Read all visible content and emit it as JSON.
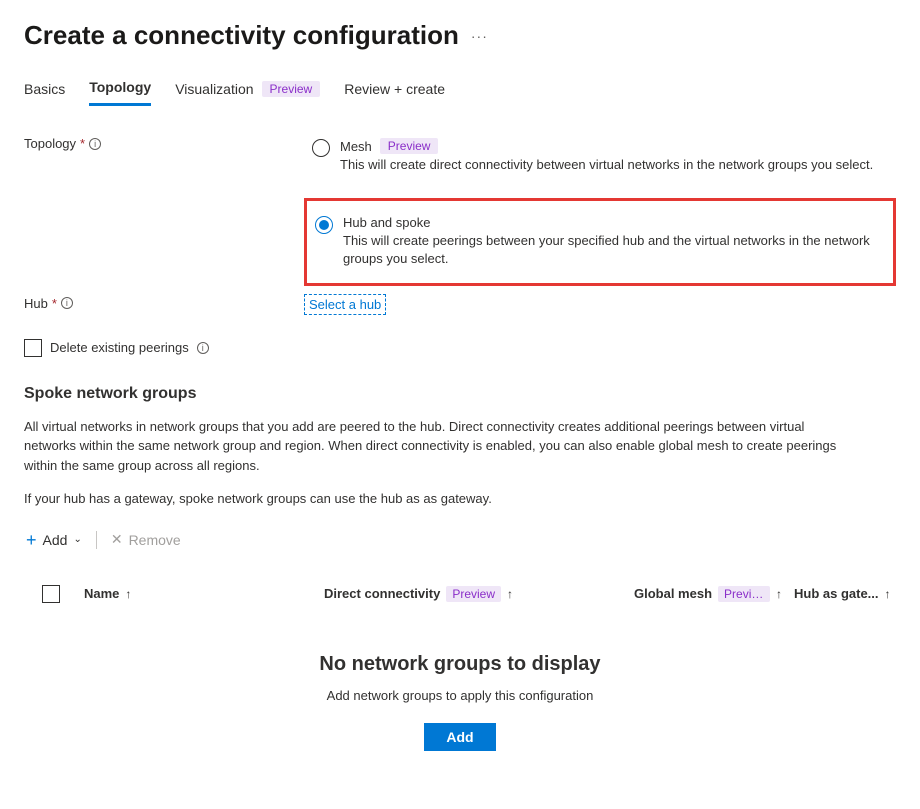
{
  "header": {
    "title": "Create a connectivity configuration"
  },
  "tabs": [
    {
      "label": "Basics",
      "active": false,
      "preview": false
    },
    {
      "label": "Topology",
      "active": true,
      "preview": false
    },
    {
      "label": "Visualization",
      "active": false,
      "preview": true
    },
    {
      "label": "Review + create",
      "active": false,
      "preview": false
    }
  ],
  "preview_label": "Preview",
  "topology": {
    "label": "Topology",
    "options": [
      {
        "label": "Mesh",
        "preview": true,
        "selected": false,
        "desc": "This will create direct connectivity between virtual networks in the network groups you select."
      },
      {
        "label": "Hub and spoke",
        "preview": false,
        "selected": true,
        "desc": "This will create peerings between your specified hub and the virtual networks in the network groups you select."
      }
    ]
  },
  "hub": {
    "label": "Hub",
    "link": "Select a hub"
  },
  "delete_peerings": {
    "label": "Delete existing peerings"
  },
  "spoke": {
    "title": "Spoke network groups",
    "desc1": "All virtual networks in network groups that you add are peered to the hub. Direct connectivity creates additional peerings between virtual networks within the same network group and region. When direct connectivity is enabled, you can also enable global mesh to create peerings within the same group across all regions.",
    "desc2": "If your hub has a gateway, spoke network groups can use the hub as as gateway."
  },
  "toolbar": {
    "add": "Add",
    "remove": "Remove"
  },
  "table": {
    "columns": {
      "name": "Name",
      "direct": "Direct connectivity",
      "global": "Global mesh",
      "global_preview": "Previe...",
      "hub": "Hub as gate..."
    }
  },
  "empty": {
    "title": "No network groups to display",
    "desc": "Add network groups to apply this configuration",
    "button": "Add"
  }
}
